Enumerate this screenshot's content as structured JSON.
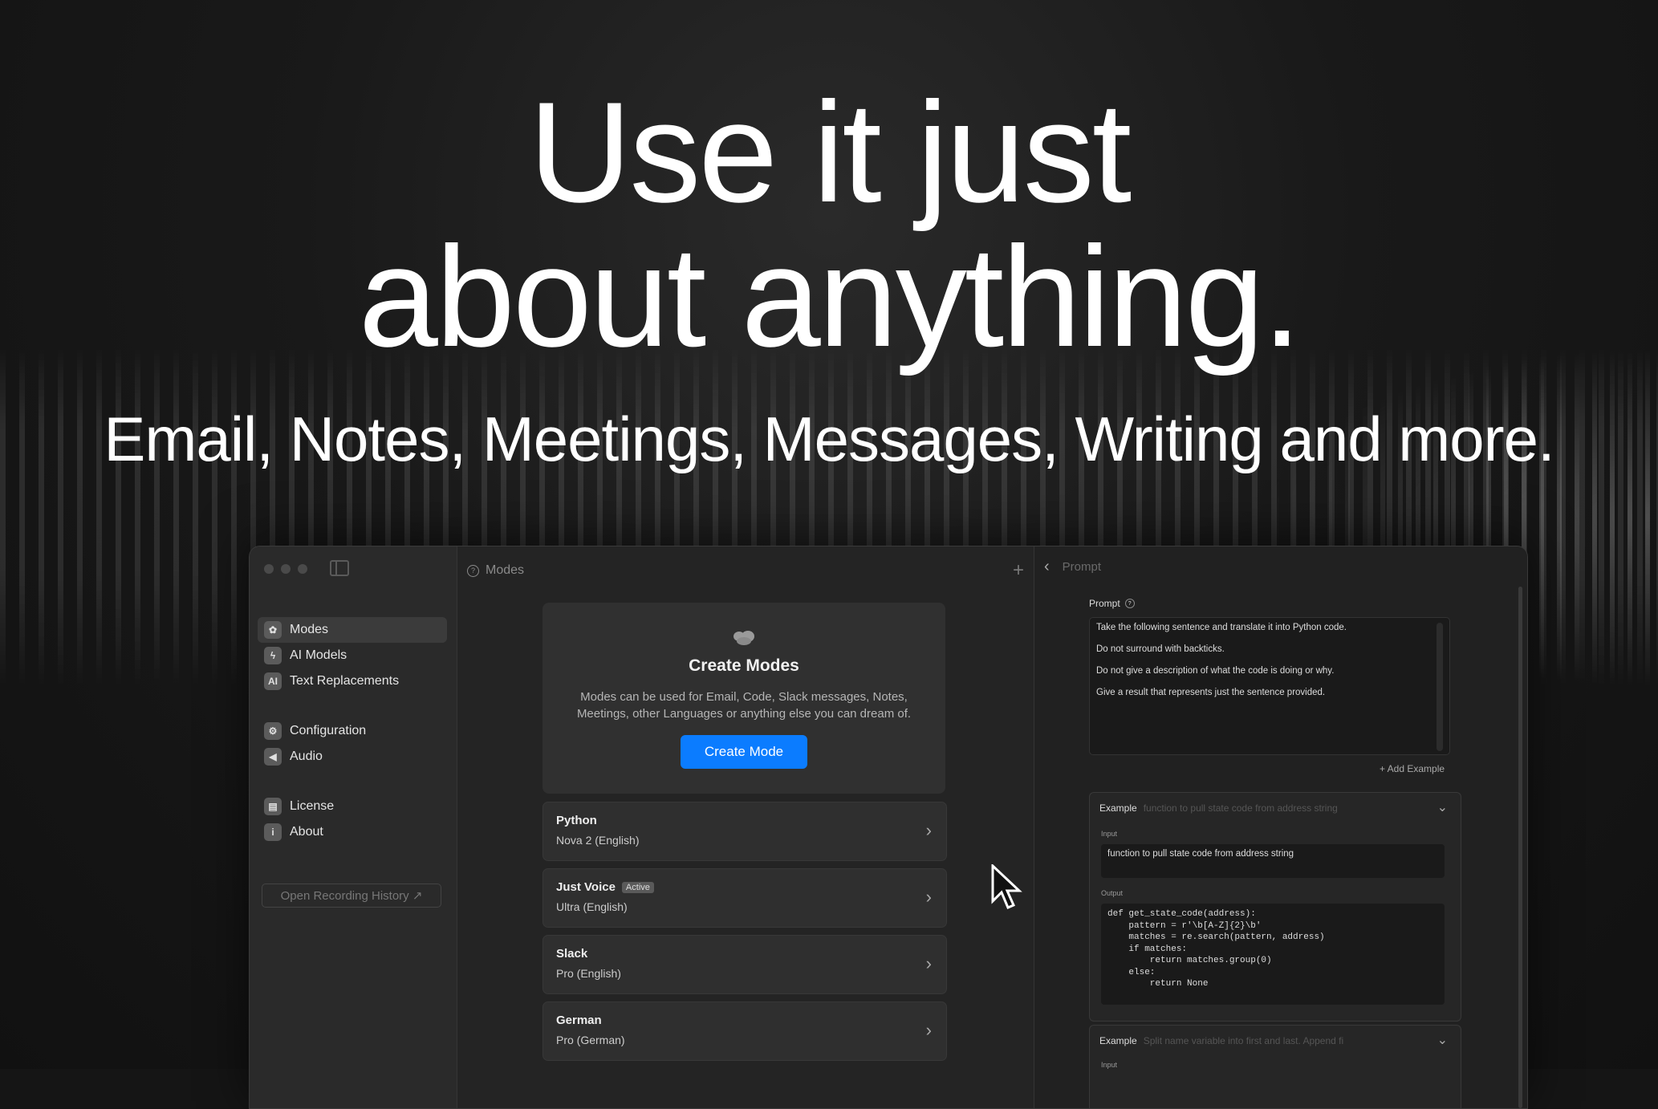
{
  "hero": {
    "headline_line1": "Use it just",
    "headline_line2": "about anything.",
    "subline": "Email, Notes, Meetings, Messages, Writing and more."
  },
  "sidebar": {
    "items": [
      {
        "label": "Modes",
        "icon": "brain-icon",
        "active": true
      },
      {
        "label": "AI Models",
        "icon": "bolt-icon"
      },
      {
        "label": "Text Replacements",
        "icon": "text-ai-icon"
      },
      {
        "label": "Configuration",
        "icon": "gear-icon"
      },
      {
        "label": "Audio",
        "icon": "speaker-icon"
      },
      {
        "label": "License",
        "icon": "license-icon"
      },
      {
        "label": "About",
        "icon": "info-icon"
      }
    ],
    "history_button": "Open Recording History ↗"
  },
  "main": {
    "title": "Modes",
    "create_card": {
      "title": "Create Modes",
      "description": "Modes can be used for Email, Code, Slack messages, Notes, Meetings, other Languages or anything else you can dream of.",
      "button": "Create Mode"
    },
    "modes": [
      {
        "name": "Python",
        "model": "Nova 2 (English)",
        "badge": ""
      },
      {
        "name": "Just Voice",
        "model": "Ultra (English)",
        "badge": "Active"
      },
      {
        "name": "Slack",
        "model": "Pro (English)",
        "badge": ""
      },
      {
        "name": "German",
        "model": "Pro (German)",
        "badge": ""
      }
    ]
  },
  "prompt_pane": {
    "title": "Prompt",
    "prompt_label": "Prompt",
    "prompt_lines": [
      "Take the following sentence and translate it into Python code.",
      "Do not surround with backticks.",
      "Do not give a description of what the code is doing or why.",
      "Give a result that represents just the sentence provided."
    ],
    "add_example": "+ Add Example",
    "examples": [
      {
        "label": "Example",
        "summary": "function to pull state code from address string",
        "input_label": "Input",
        "input": "function to pull state code from address string",
        "output_label": "Output",
        "output": "def get_state_code(address):\n    pattern = r'\\b[A-Z]{2}\\b'\n    matches = re.search(pattern, address)\n    if matches:\n        return matches.group(0)\n    else:\n        return None"
      },
      {
        "label": "Example",
        "summary": "Split name variable into first and last. Append fi",
        "input_label": "Input"
      }
    ]
  }
}
